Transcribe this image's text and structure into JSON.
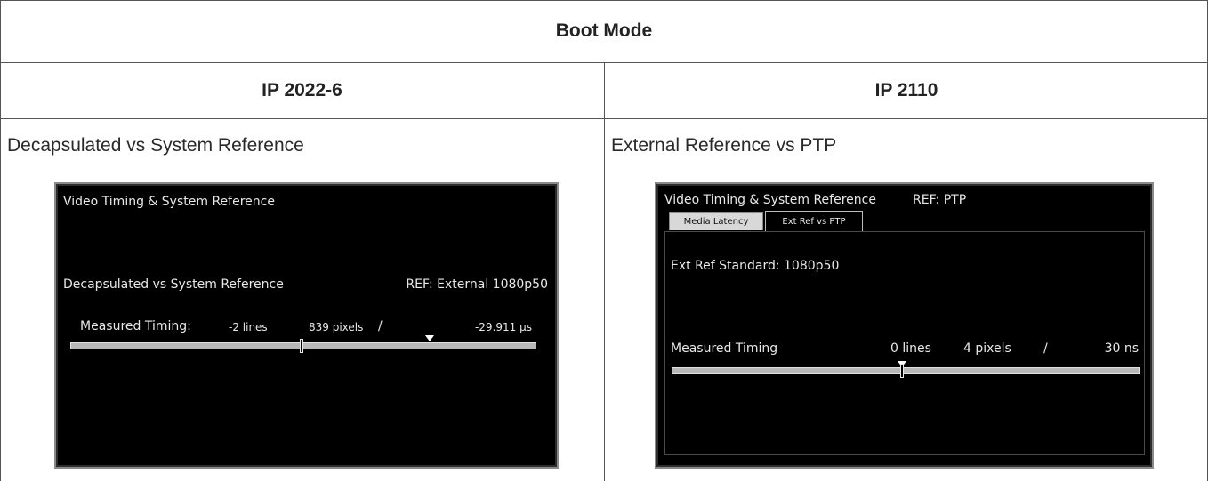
{
  "table": {
    "header": "Boot Mode",
    "columns": [
      "IP 2022-6",
      "IP 2110"
    ],
    "captions": [
      "Decapsulated vs System Reference",
      "External Reference vs PTP"
    ]
  },
  "left_screen": {
    "title": "Video Timing & System Reference",
    "section_label": "Decapsulated vs System Reference",
    "ref_label": "REF: External 1080p50",
    "measured_label": "Measured Timing:",
    "lines": "-2 lines",
    "pixels": "839 pixels",
    "separator": "/",
    "time": "-29.911 µs"
  },
  "right_screen": {
    "title": "Video Timing & System Reference",
    "ref_label": "REF: PTP",
    "tabs": [
      "Media Latency",
      "Ext Ref vs PTP"
    ],
    "active_tab": "Ext Ref vs PTP",
    "standard": "Ext Ref Standard: 1080p50",
    "measured_label": "Measured Timing",
    "lines": "0 lines",
    "pixels": "4 pixels",
    "separator": "/",
    "time": "30 ns"
  },
  "colors": {
    "screen_bg": "#000000",
    "screen_text": "#e8e8e8",
    "bar_fill": "#b8b8b8",
    "table_border": "#555555"
  }
}
